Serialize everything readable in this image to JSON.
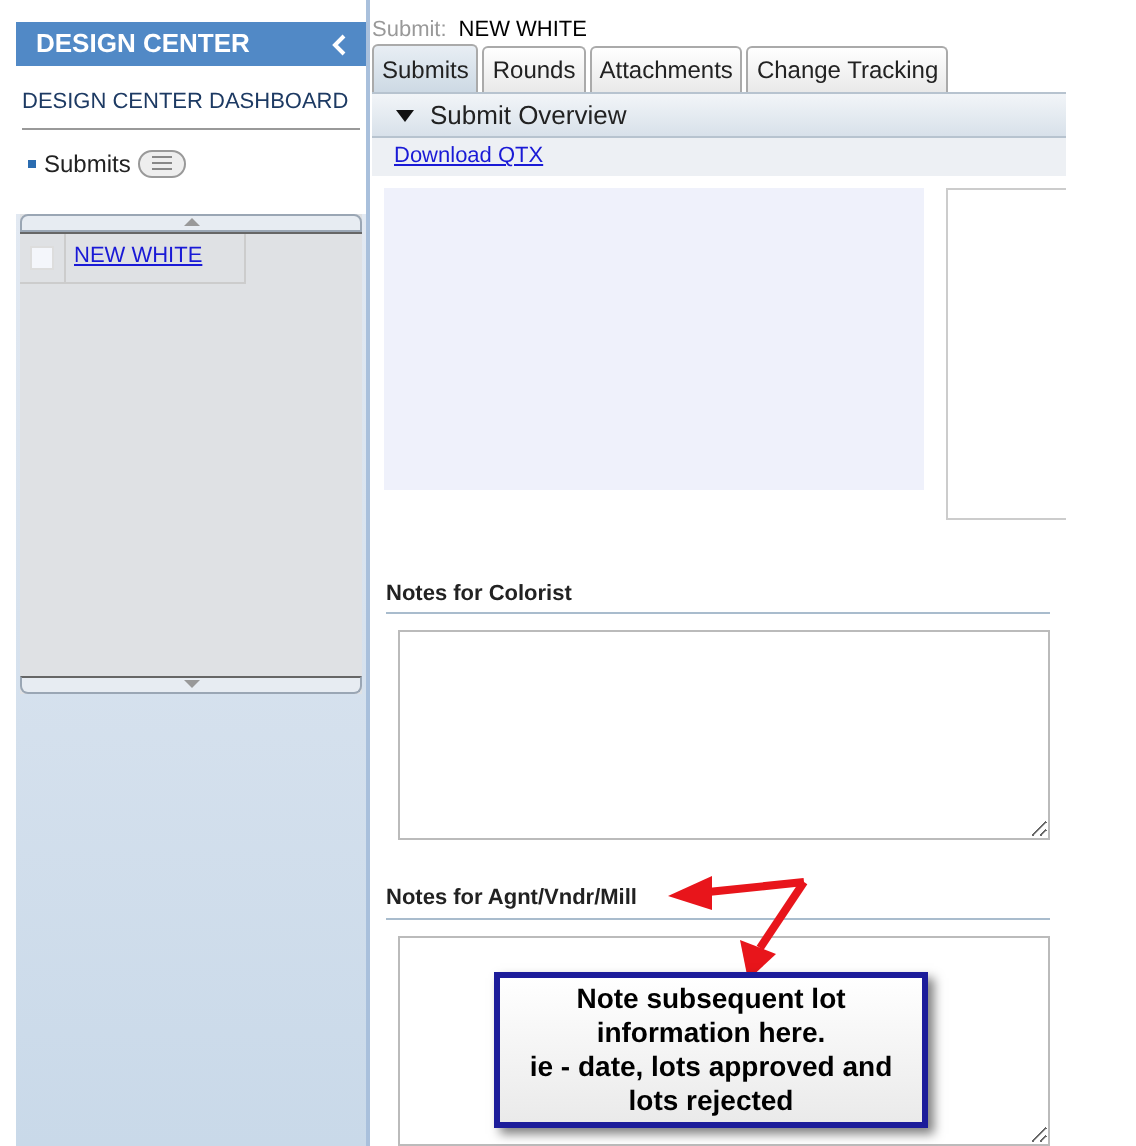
{
  "sidebar": {
    "title": "DESIGN CENTER",
    "dashboard_link": "DESIGN CENTER DASHBOARD",
    "items": [
      {
        "label": "Submits"
      }
    ],
    "grid": {
      "rows": [
        {
          "label": "NEW WHITE",
          "checked": false
        }
      ]
    }
  },
  "breadcrumb": {
    "label": "Submit:",
    "value": "NEW WHITE"
  },
  "tabs": [
    {
      "label": "Submits",
      "selected": true
    },
    {
      "label": "Rounds",
      "selected": false
    },
    {
      "label": "Attachments",
      "selected": false
    },
    {
      "label": "Change Tracking",
      "selected": false
    }
  ],
  "section": {
    "title": "Submit Overview",
    "expanded": true
  },
  "download_link": "Download QTX",
  "notes": [
    {
      "label": "Notes for Colorist"
    },
    {
      "label": "Notes for Agnt/Vndr/Mill"
    }
  ],
  "callout": {
    "lines": [
      "Note subsequent lot information here.",
      "ie - date, lots approved and lots rejected"
    ]
  }
}
